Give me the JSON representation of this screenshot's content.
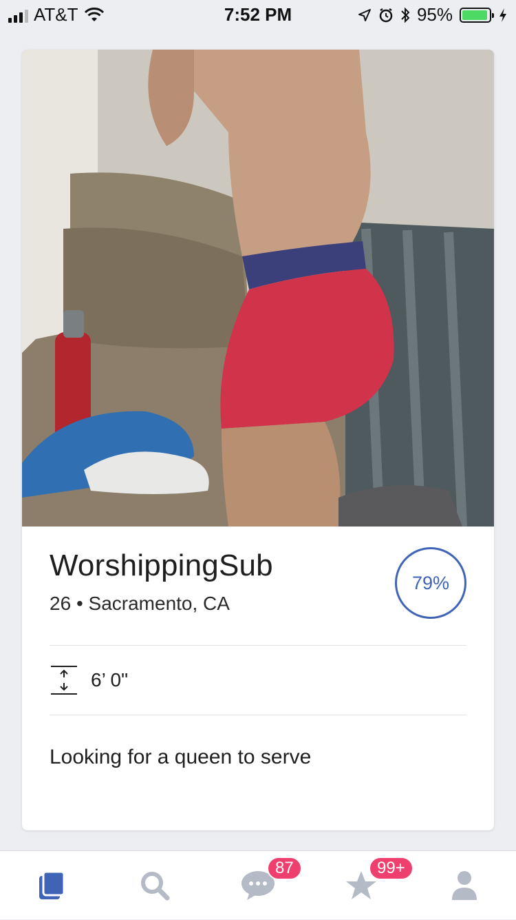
{
  "status_bar": {
    "carrier": "AT&T",
    "time": "7:52 PM",
    "battery_percent": "95%",
    "battery_level": 0.95,
    "battery_color": "#4cd964"
  },
  "profile": {
    "username": "WorshippingSub",
    "age": "26",
    "separator": "•",
    "location": "Sacramento, CA",
    "match_percent": "79%",
    "height": "6’ 0\"",
    "bio": "Looking for a queen to serve",
    "accent_color": "#3f63b5"
  },
  "tab_bar": {
    "tabs": [
      {
        "icon": "cards-icon",
        "active": true
      },
      {
        "icon": "search-icon",
        "active": false
      },
      {
        "icon": "chat-bubble-icon",
        "badge": "87"
      },
      {
        "icon": "star-icon",
        "badge": "99+"
      },
      {
        "icon": "person-icon",
        "active": false
      }
    ],
    "active_color": "#3f63b5",
    "inactive_color": "#b4bac6",
    "badge_color": "#ef3f6e"
  }
}
